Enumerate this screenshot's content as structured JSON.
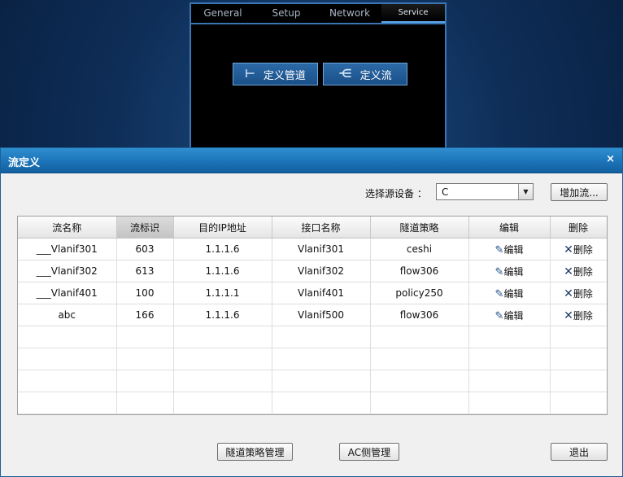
{
  "background": {
    "tabs": [
      "General",
      "Setup",
      "Network",
      "Service"
    ],
    "active_tab": "Service",
    "buttons": {
      "define_pipe": "定义管道",
      "define_flow": "定义流"
    }
  },
  "dialog": {
    "title": "流定义",
    "close_glyph": "×",
    "source_label": "选择源设备 ：",
    "source_value": "C",
    "add_flow_button": "增加流...",
    "table": {
      "headers": [
        "流名称",
        "流标识",
        "目的IP地址",
        "接口名称",
        "隧道策略",
        "编辑",
        "删除"
      ],
      "rows": [
        {
          "name": "___Vlanif301",
          "id": "603",
          "ip": "1.1.1.6",
          "iface": "Vlanif301",
          "policy": "ceshi"
        },
        {
          "name": "___Vlanif302",
          "id": "613",
          "ip": "1.1.1.6",
          "iface": "Vlanif302",
          "policy": "flow306"
        },
        {
          "name": "___Vlanif401",
          "id": "100",
          "ip": "1.1.1.1",
          "iface": "Vlanif401",
          "policy": "policy250"
        },
        {
          "name": "abc",
          "id": "166",
          "ip": "1.1.1.6",
          "iface": "Vlanif500",
          "policy": "flow306"
        }
      ],
      "edit_label": "编辑",
      "delete_label": "删除",
      "empty_rows": 4
    },
    "footer": {
      "tunnel_mgmt": "隧道策略管理",
      "ac_mgmt": "AC侧管理",
      "exit": "退出"
    }
  }
}
